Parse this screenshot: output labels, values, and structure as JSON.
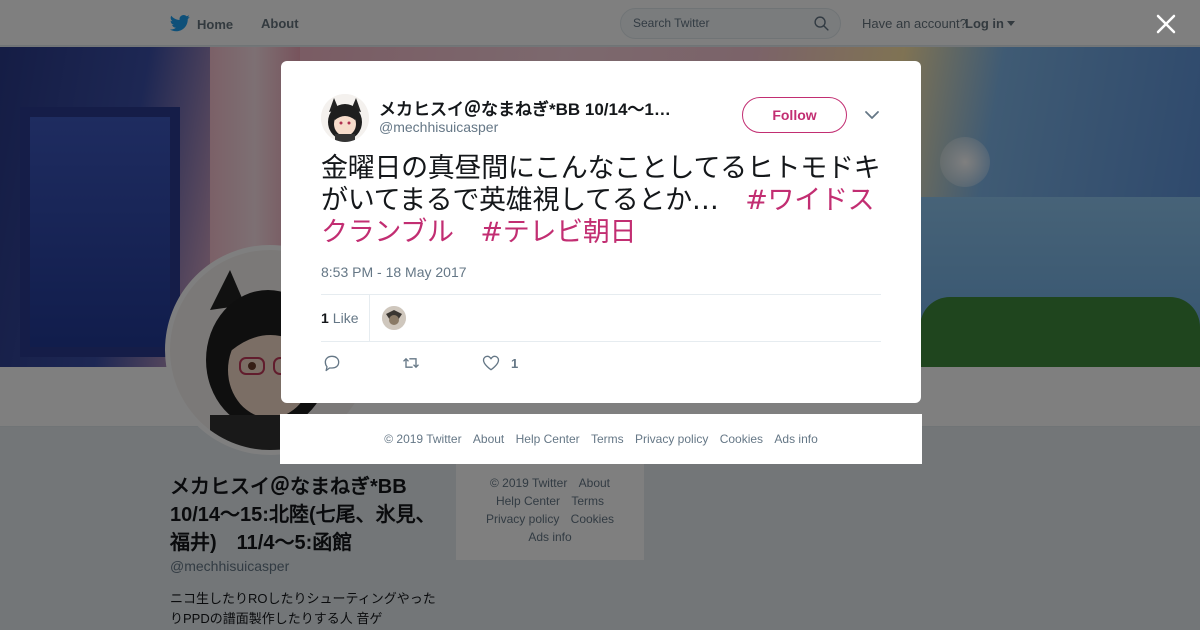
{
  "topbar": {
    "home_label": "Home",
    "about_label": "About",
    "search_placeholder": "Search Twitter",
    "account_prompt": "Have an account?",
    "login_label": "Log in"
  },
  "profile": {
    "name": "メカヒスイ＠なまねぎ*BB 10/14～15:北陸(七尾、氷見、福井)　11/4～5:函館",
    "handle": "@mechhisuicasper",
    "bio": "ニコ生したりROしたりシューティングやったりPPDの譜面製作したりする人 音ゲ"
  },
  "side_footer": {
    "links": [
      "© 2019 Twitter",
      "About",
      "Help Center",
      "Terms",
      "Privacy policy",
      "Cookies",
      "Ads info"
    ]
  },
  "tweet": {
    "author_name": "メカヒスイ＠なまねぎ*BB 10/14～1…",
    "author_handle": "@mechhisuicasper",
    "follow_label": "Follow",
    "text": "金曜日の真昼間にこんなことしてるヒトモドキがいてまるで英雄視してるとか…　",
    "hashtag_1": "#ワイドスクランブル",
    "hashtag_2": "#テレビ朝日",
    "timestamp": "8:53 PM - 18 May 2017",
    "likes_count": "1",
    "likes_label": "Like",
    "like_action_count": "1"
  },
  "modal_footer": {
    "links": [
      "© 2019 Twitter",
      "About",
      "Help Center",
      "Terms",
      "Privacy policy",
      "Cookies",
      "Ads info"
    ]
  },
  "colors": {
    "accent": "#c22e72",
    "twitter_blue": "#1da1f2",
    "muted_text": "#657786"
  },
  "icons": {
    "logo": "twitter-bird-icon",
    "search": "search-icon",
    "close": "close-icon",
    "menu": "chevron-down-icon",
    "reply": "reply-icon",
    "retweet": "retweet-icon",
    "like": "heart-icon"
  }
}
